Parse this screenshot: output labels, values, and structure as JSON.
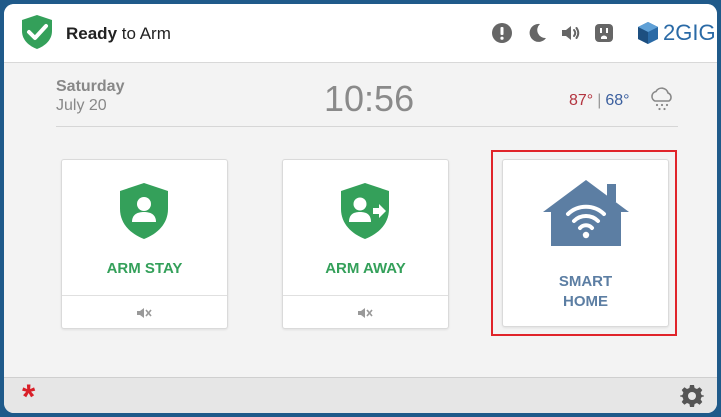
{
  "status": {
    "bold": "Ready",
    "rest": " to Arm"
  },
  "brand": {
    "name": "2GIG"
  },
  "date": {
    "day": "Saturday",
    "date": "July 20"
  },
  "time": "10:56",
  "weather": {
    "high": "87°",
    "separator": "|",
    "low": "68°"
  },
  "tiles": {
    "arm_stay": "ARM STAY",
    "arm_away": "ARM AWAY",
    "smart_home_line1": "SMART",
    "smart_home_line2": "HOME"
  },
  "colors": {
    "green": "#34a05a",
    "home_blue": "#5c7ea3",
    "highlight_red": "#e0242a",
    "emergency_red": "#d92029"
  },
  "bottom": {
    "emergency_symbol": "*"
  }
}
